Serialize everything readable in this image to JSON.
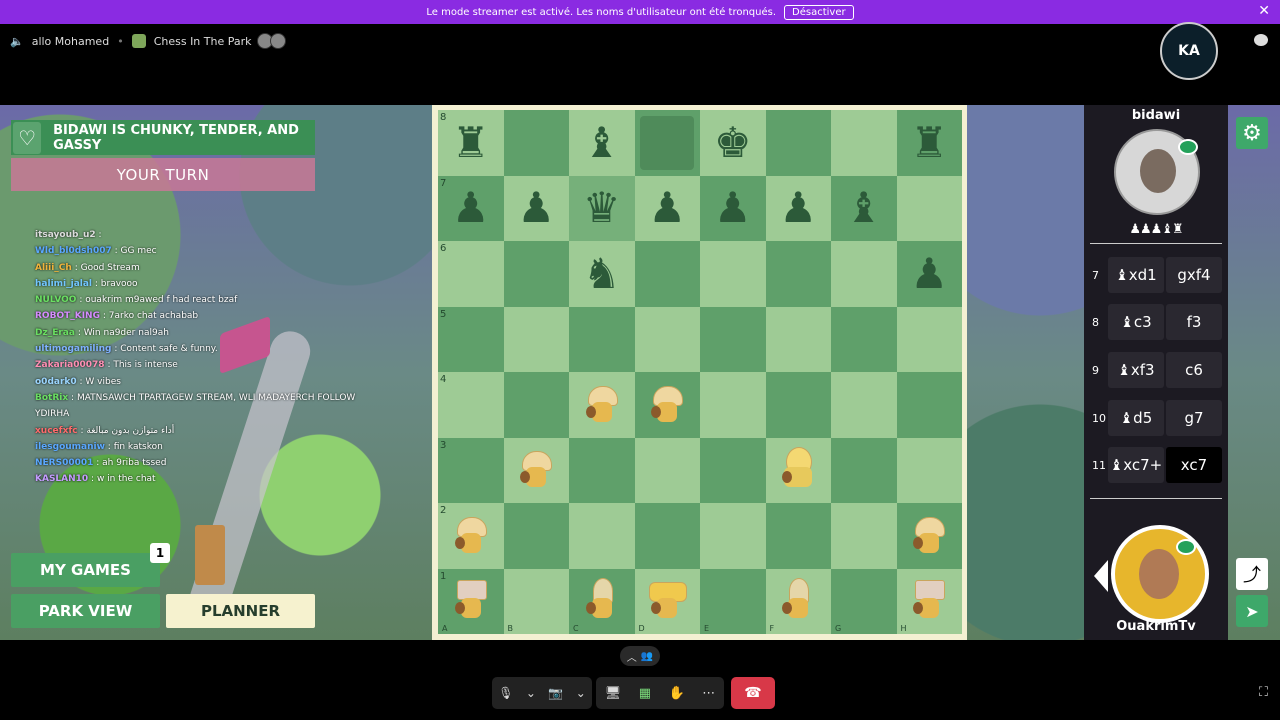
{
  "banner": {
    "text": "Le mode streamer est activé. Les noms d'utilisateur ont été tronqués.",
    "button": "Désactiver",
    "close": "✕"
  },
  "call": {
    "user": "allo Mohamed",
    "activity": "Chess In The Park"
  },
  "logo": {
    "text": "KA"
  },
  "game": {
    "heading": "BIDAWI IS CHUNKY, TENDER, AND GASSY",
    "turn": "YOUR TURN",
    "buttons": {
      "games": "MY GAMES",
      "games_badge": "1",
      "park": "PARK VIEW",
      "planner": "PLANNER"
    }
  },
  "chat": [
    {
      "user": "itsayoub_u2",
      "msg": "",
      "color": "#dddddd"
    },
    {
      "user": "Wld_bl0dsh007",
      "msg": "GG mec",
      "color": "#5aa8ff"
    },
    {
      "user": "Aliii_Ch",
      "msg": "Good Stream",
      "color": "#f0b33b"
    },
    {
      "user": "halimi_jalal",
      "msg": "bravooo",
      "color": "#72c7ff"
    },
    {
      "user": "NULVOO",
      "msg": "ouakrim m9awed f had react bzaf",
      "color": "#6adf62"
    },
    {
      "user": "ROBOT_KING",
      "msg": "7arko chat achabab",
      "color": "#d68bff"
    },
    {
      "user": "Dz_Eraa",
      "msg": "Win na9der nal9ah",
      "color": "#6adf62"
    },
    {
      "user": "ultimogamiling",
      "msg": "Content safe & funny.",
      "color": "#7fb2ff"
    },
    {
      "user": "Zakaria00078",
      "msg": "This is intense",
      "color": "#ff8fb4"
    },
    {
      "user": "o0dark0",
      "msg": "W vibes",
      "color": "#9bd6ff"
    },
    {
      "user": "BotRix",
      "msg": "MATNSAWCH TPARTAGEW STREAM, WLI MADAYERCH FOLLOW YDIRHA",
      "color": "#6adf62"
    },
    {
      "user": "xucefxfc",
      "msg": "أداء متوازن بدون مبالغة",
      "color": "#ff6b6b"
    },
    {
      "user": "ilesgoumaniw",
      "msg": "fin katskon",
      "color": "#5aa8ff"
    },
    {
      "user": "NERS00001",
      "msg": "ah 9riba tssed",
      "color": "#5aa8ff"
    },
    {
      "user": "KASLAN10",
      "msg": "w in the chat",
      "color": "#c49bff"
    }
  ],
  "board": {
    "ranks": [
      "8",
      "7",
      "6",
      "5",
      "4",
      "3",
      "2",
      "1"
    ],
    "files": [
      "A",
      "B",
      "C",
      "D",
      "E",
      "F",
      "G",
      "H"
    ]
  },
  "moves_panel": {
    "opponent": "bidawi",
    "captured": "♟♟♟♝♜",
    "player": "OuakrimTv",
    "moves": [
      {
        "n": "7",
        "w": "♝xd1",
        "b": "gxf4"
      },
      {
        "n": "8",
        "w": "♝c3",
        "b": "f3"
      },
      {
        "n": "9",
        "w": "♝xf3",
        "b": "c6"
      },
      {
        "n": "10",
        "w": "♝d5",
        "b": "g7"
      },
      {
        "n": "11",
        "w": "♝xc7+",
        "b": "xc7"
      }
    ]
  },
  "controls": {
    "mic": "🎙",
    "cam": "📷",
    "share": "🖥",
    "apps": "▦",
    "react": "✋",
    "more": "⋯",
    "leave": "☎",
    "fullscreen": "⛶"
  }
}
